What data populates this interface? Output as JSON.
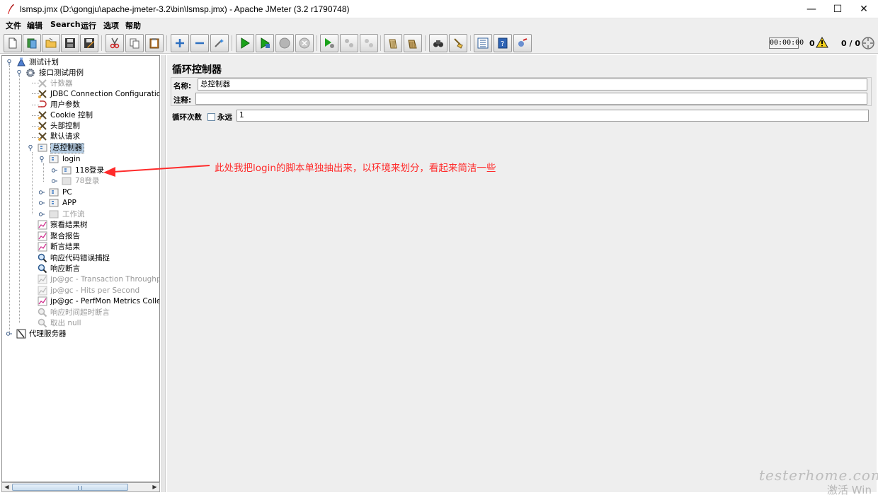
{
  "window": {
    "title": "lsmsp.jmx (D:\\gongju\\apache-jmeter-3.2\\bin\\lsmsp.jmx) - Apache JMeter (3.2 r1790748)",
    "minimize": "—",
    "maximize": "☐",
    "close": "✕"
  },
  "menu": [
    "文件",
    "编辑",
    "Search",
    "运行",
    "选项",
    "帮助"
  ],
  "status": {
    "timer": "00:00:00",
    "error_count": "0",
    "threads": "0 / 0"
  },
  "tree": {
    "items": [
      {
        "label": "测试计划",
        "icon": "test-plan-icon",
        "disabled": false
      },
      {
        "label": "接口测试用例",
        "icon": "thread-group-gear-icon",
        "disabled": false
      },
      {
        "label": "计数器",
        "icon": "config-scissors-icon",
        "disabled": true
      },
      {
        "label": "JDBC Connection Configuration",
        "icon": "config-scissors-icon",
        "disabled": false
      },
      {
        "label": "用户参数",
        "icon": "pre-processor-icon",
        "disabled": false
      },
      {
        "label": "Cookie 控制",
        "icon": "config-scissors-icon",
        "disabled": false
      },
      {
        "label": "头部控制",
        "icon": "config-scissors-icon",
        "disabled": false
      },
      {
        "label": "默认请求",
        "icon": "config-scissors-icon",
        "disabled": false
      },
      {
        "label": "总控制器",
        "icon": "controller-icon",
        "disabled": false
      },
      {
        "label": "login",
        "icon": "controller-icon",
        "disabled": false
      },
      {
        "label": "118登录",
        "icon": "controller-icon",
        "disabled": false
      },
      {
        "label": "78登录",
        "icon": "controller-icon",
        "disabled": true
      },
      {
        "label": "PC",
        "icon": "controller-icon",
        "disabled": false
      },
      {
        "label": "APP",
        "icon": "controller-icon",
        "disabled": false
      },
      {
        "label": "工作流",
        "icon": "controller-icon",
        "disabled": true
      },
      {
        "label": "察看结果树",
        "icon": "listener-graph-icon",
        "disabled": false
      },
      {
        "label": "聚合报告",
        "icon": "listener-graph-icon",
        "disabled": false
      },
      {
        "label": "断言结果",
        "icon": "listener-graph-icon",
        "disabled": false
      },
      {
        "label": "响应代码错误捕捉",
        "icon": "assertion-magnifier-icon",
        "disabled": false
      },
      {
        "label": "响应断言",
        "icon": "assertion-magnifier-icon",
        "disabled": false
      },
      {
        "label": "jp@gc - Transaction Throughput vs",
        "icon": "listener-graph-icon",
        "disabled": true
      },
      {
        "label": "jp@gc - Hits per Second",
        "icon": "listener-graph-icon",
        "disabled": true
      },
      {
        "label": "jp@gc - PerfMon Metrics Collector",
        "icon": "listener-graph-icon",
        "disabled": false
      },
      {
        "label": "响应时间超时断言",
        "icon": "assertion-magnifier-icon",
        "disabled": true
      },
      {
        "label": "取出 null",
        "icon": "assertion-magnifier-icon",
        "disabled": true
      },
      {
        "label": "代理服务器",
        "icon": "workbench-icon",
        "disabled": false
      }
    ]
  },
  "panel": {
    "title": "循环控制器",
    "name_label": "名称:",
    "name_value": "总控制器",
    "comment_label": "注释:",
    "comment_value": "",
    "loop_label": "循环次数",
    "forever_label": "永远",
    "loop_value": "1"
  },
  "annotation": "此处我把login的脚本单独抽出来，以环境来划分，看起来简洁一些",
  "watermark": {
    "site": "testerhome.com",
    "activate": "激活 Win"
  },
  "colors": {
    "annotation_red": "#ff2b2b",
    "selection_blue": "#b8cfe5",
    "toolbar_bg": "#eeeeee",
    "disabled_text": "#9a9a9a"
  }
}
